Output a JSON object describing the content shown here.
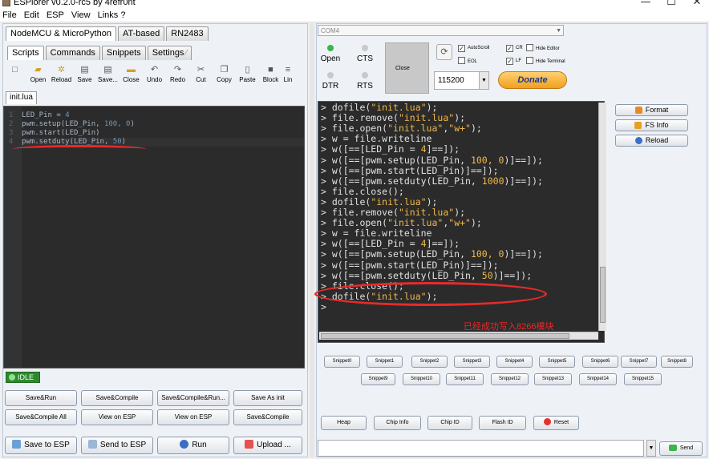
{
  "window": {
    "title": "ESPlorer v0.2.0-rc5 by 4refr0nt",
    "minimize": "—",
    "maximize": "☐",
    "close": "✕"
  },
  "menu": [
    "File",
    "Edit",
    "ESP",
    "View",
    "Links ?"
  ],
  "left": {
    "top_tabs": [
      "NodeMCU & MicroPython",
      "AT-based",
      "RN2483"
    ],
    "sub_tabs": [
      "Scripts",
      "Commands",
      "Snippets",
      "Settings"
    ],
    "toolbar": [
      "Open",
      "Reload",
      "Save",
      "Save...",
      "Close",
      "Undo",
      "Redo",
      "Cut",
      "Copy",
      "Paste",
      "Block",
      "Lin"
    ],
    "file_tab": "init.lua",
    "code_lines": [
      {
        "n": "1",
        "pre": "LED_Pin = ",
        "num": "4",
        "post": ""
      },
      {
        "n": "2",
        "pre": "pwm.setup(LED_Pin, ",
        "num": "100, 0",
        "post": ")"
      },
      {
        "n": "3",
        "pre": "pwm.start(LED_Pin)",
        "num": "",
        "post": ""
      },
      {
        "n": "4",
        "pre": "pwm.setduty(LED_Pin, ",
        "num": "50",
        "post": ")"
      }
    ],
    "status": "IDLE",
    "buttons": {
      "save_run": "Save&Run",
      "save_compile": "Save&Compile",
      "save_compile_run": "Save&Compile&Run...",
      "save_as_init": "Save As init",
      "save_compile_all": "Save&Compile All",
      "view_on_esp": "View on ESP",
      "view_on_esp2": "View on ESP",
      "save_compile2": "Save&Compile",
      "save_to_esp": "Save to ESP",
      "send_to_esp": "Send to ESP",
      "run": "Run",
      "upload": "Upload ..."
    }
  },
  "right": {
    "port": "COM4",
    "open": "Open",
    "cts": "CTS",
    "dtr": "DTR",
    "rts": "RTS",
    "close": "Close",
    "checks": [
      {
        "label": "AutoScroll",
        "checked": true
      },
      {
        "label": "CR",
        "checked": true
      },
      {
        "label": "Hide Editor",
        "checked": false
      },
      {
        "label": "EOL",
        "checked": false
      },
      {
        "label": "LF",
        "checked": true
      },
      {
        "label": "Hide Terminal",
        "checked": false
      }
    ],
    "baud": "115200",
    "donate": "Donate",
    "side_buttons": [
      "Format",
      "FS Info",
      "Reload"
    ],
    "annotation": "已经成功写入8266模块",
    "snippets_row1": [
      "Snippet0",
      "Snippet1",
      "Snippet2",
      "Snippet3",
      "Snippet4",
      "Snippet5",
      "Snippet6",
      "Snippet7",
      "Snippet8"
    ],
    "snippets_row2": [
      "Snippet9",
      "Snippet10",
      "Snippet11",
      "Snippet12",
      "Snippet13",
      "Snippet14",
      "Snippet15"
    ],
    "bottom_buttons": [
      "Heap",
      "Chip Info",
      "Chip ID",
      "Flash ID",
      "Reset"
    ],
    "send": "Send"
  },
  "terminal": [
    [
      [
        "> dofile(",
        ""
      ],
      [
        "\"init.lua\"",
        "s"
      ],
      [
        ");",
        ""
      ]
    ],
    [
      [
        "> file.remove(",
        ""
      ],
      [
        "\"init.lua\"",
        "s"
      ],
      [
        ");",
        ""
      ]
    ],
    [
      [
        "> file.open(",
        ""
      ],
      [
        "\"init.lua\"",
        "s"
      ],
      [
        ",",
        ""
      ],
      [
        "\"w+\"",
        "s"
      ],
      [
        ");",
        ""
      ]
    ],
    [
      [
        "> w = file.writeline",
        ""
      ]
    ],
    [
      [
        "> w([==[LED_Pin = ",
        ""
      ],
      [
        "4",
        "s"
      ],
      [
        "]==]);",
        ""
      ]
    ],
    [
      [
        "> w([==[pwm.setup(LED_Pin, ",
        ""
      ],
      [
        "100, 0",
        "s"
      ],
      [
        ")]==]);",
        ""
      ]
    ],
    [
      [
        "> w([==[pwm.start(LED_Pin)]==]);",
        ""
      ]
    ],
    [
      [
        "> w([==[pwm.setduty(LED_Pin, ",
        ""
      ],
      [
        "1000",
        "s"
      ],
      [
        ")]==]);",
        ""
      ]
    ],
    [
      [
        "> file.close();",
        ""
      ]
    ],
    [
      [
        "> dofile(",
        ""
      ],
      [
        "\"init.lua\"",
        "s"
      ],
      [
        ");",
        ""
      ]
    ],
    [
      [
        "> file.remove(",
        ""
      ],
      [
        "\"init.lua\"",
        "s"
      ],
      [
        ");",
        ""
      ]
    ],
    [
      [
        "> file.open(",
        ""
      ],
      [
        "\"init.lua\"",
        "s"
      ],
      [
        ",",
        ""
      ],
      [
        "\"w+\"",
        "s"
      ],
      [
        ");",
        ""
      ]
    ],
    [
      [
        "> w = file.writeline",
        ""
      ]
    ],
    [
      [
        "> w([==[LED_Pin = ",
        ""
      ],
      [
        "4",
        "s"
      ],
      [
        "]==]);",
        ""
      ]
    ],
    [
      [
        "> w([==[pwm.setup(LED_Pin, ",
        ""
      ],
      [
        "100, 0",
        "s"
      ],
      [
        ")]==]);",
        ""
      ]
    ],
    [
      [
        "> w([==[pwm.start(LED_Pin)]==]);",
        ""
      ]
    ],
    [
      [
        "> w([==[pwm.setduty(LED_Pin, ",
        ""
      ],
      [
        "50",
        "s"
      ],
      [
        ")]==]);",
        ""
      ]
    ],
    [
      [
        "> file.close();",
        ""
      ]
    ],
    [
      [
        "> dofile(",
        ""
      ],
      [
        "\"init.lua\"",
        "s"
      ],
      [
        ");",
        ""
      ]
    ],
    [
      [
        ">",
        ""
      ]
    ]
  ]
}
